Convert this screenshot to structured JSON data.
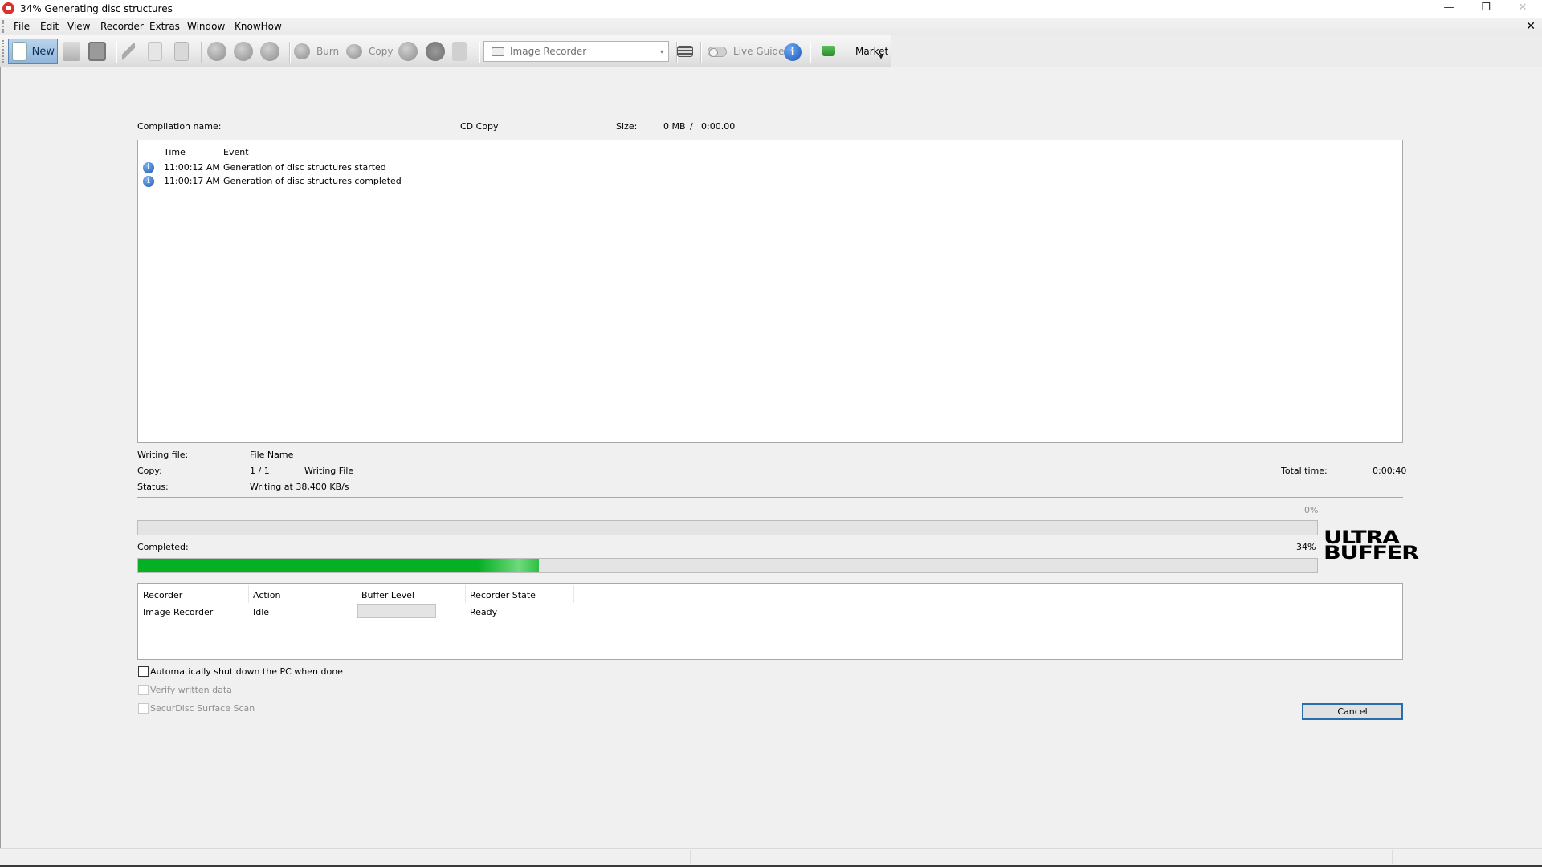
{
  "window": {
    "title": "34% Generating disc structures",
    "controls": {
      "minimize": "—",
      "restore": "❐",
      "close": "✕"
    },
    "mdi_close": "✕"
  },
  "menu": [
    "File",
    "Edit",
    "View",
    "Recorder",
    "Extras",
    "Window",
    "KnowHow"
  ],
  "toolbar": {
    "new_label": "New",
    "burn_label": "Burn",
    "copy_label": "Copy",
    "recorder_select": {
      "value": "Image Recorder",
      "caret": "▾"
    },
    "live_guide_label": "Live Guide",
    "info_glyph": "i",
    "market_label": "Market",
    "overflow_glyph": "▾",
    "icons": [
      "new-document-icon",
      "open-icon",
      "save-icon",
      "cut-icon",
      "copy-icon",
      "paste-icon",
      "home-icon",
      "disc-info-icon",
      "erase-icon",
      "burn-icon",
      "copy-disc-icon",
      "disc-info-i-icon",
      "eject-icon",
      "drive-icon",
      "recorder-icon",
      "toggle-icon",
      "info-icon",
      "market-icon"
    ]
  },
  "compilation": {
    "name_label": "Compilation name:",
    "name_value": "CD Copy",
    "size_label": "Size:",
    "size_value": "0 MB",
    "size_sep": "/",
    "duration_value": "0:00.00"
  },
  "log": {
    "columns": [
      "Time",
      "Event"
    ],
    "rows": [
      {
        "icon": "info-icon",
        "time": "11:00:12 AM",
        "event": "Generation of disc structures started"
      },
      {
        "icon": "info-icon",
        "time": "11:00:17 AM",
        "event": "Generation of disc structures completed"
      }
    ]
  },
  "details": {
    "writing_file_label": "Writing file:",
    "writing_file_value": "File Name",
    "copy_label": "Copy:",
    "copy_value": "1 / 1",
    "copy_action": "Writing File",
    "status_label": "Status:",
    "status_value": "Writing at 38,400 KB/s",
    "total_time_label": "Total time:",
    "total_time_value": "0:00:40"
  },
  "progress": {
    "track_percent_label": "0%",
    "track_percent": 0,
    "completed_label": "Completed:",
    "completed_percent_label": "34%",
    "completed_percent": 34,
    "accent": "#06b025"
  },
  "logo": {
    "line1": "ULTRA",
    "line2": "BUFFER"
  },
  "recorders": {
    "columns": [
      "Recorder",
      "Action",
      "Buffer Level",
      "Recorder State"
    ],
    "rows": [
      {
        "recorder": "Image Recorder",
        "action": "Idle",
        "buffer_level": 0,
        "state": "Ready"
      }
    ]
  },
  "options": [
    {
      "label": "Automatically shut down the PC when done",
      "checked": false,
      "enabled": true
    },
    {
      "label": "Verify written data",
      "checked": false,
      "enabled": false
    },
    {
      "label": "SecurDisc Surface Scan",
      "checked": false,
      "enabled": false
    }
  ],
  "cancel_label": "Cancel"
}
